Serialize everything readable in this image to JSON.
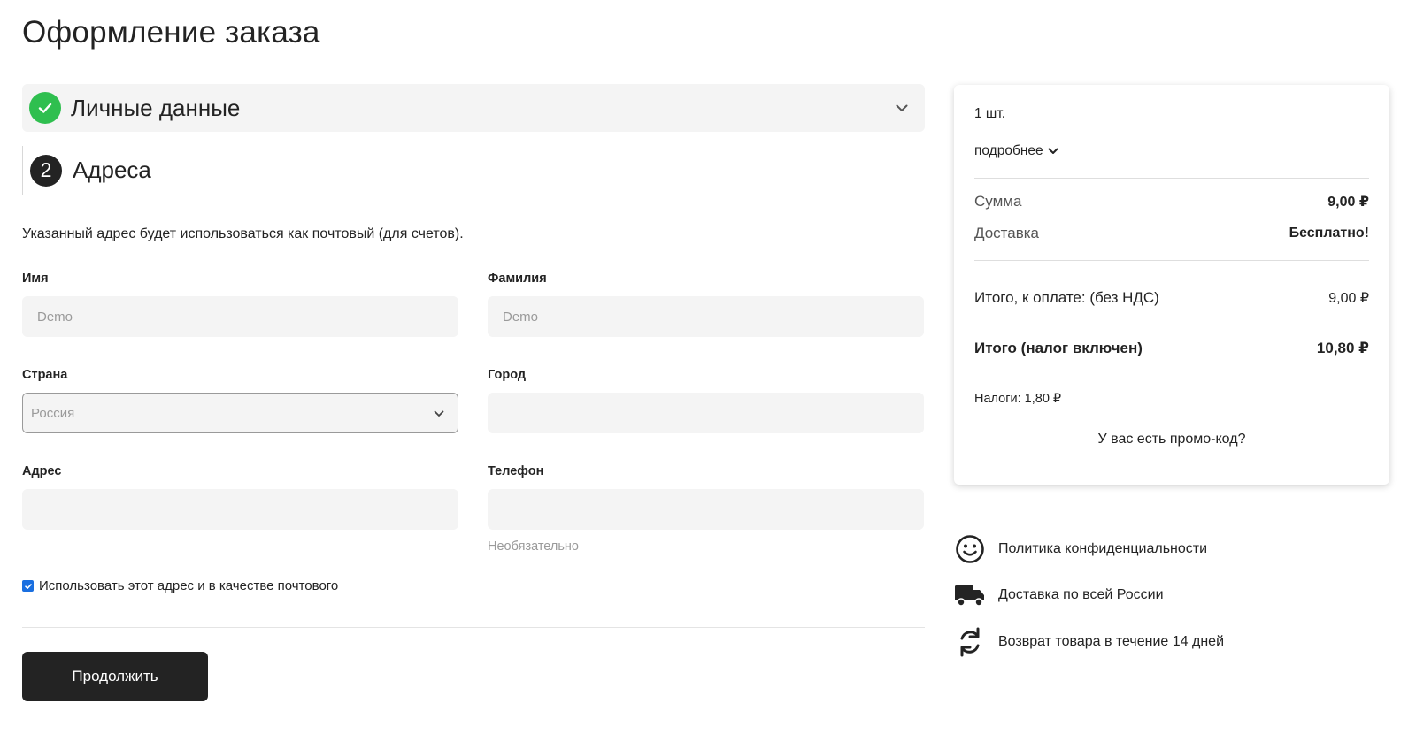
{
  "page": {
    "title": "Оформление заказа"
  },
  "steps": {
    "personal": {
      "title": "Личные данные",
      "done": true
    },
    "address": {
      "number": "2",
      "title": "Адреса"
    }
  },
  "address_form": {
    "info": "Указанный адрес будет использоваться как почтовый (для счетов).",
    "first_name": {
      "label": "Имя",
      "value": "Demo"
    },
    "last_name": {
      "label": "Фамилия",
      "value": "Demo"
    },
    "country": {
      "label": "Страна",
      "selected": "Россия"
    },
    "city": {
      "label": "Город",
      "value": ""
    },
    "address": {
      "label": "Адрес",
      "value": ""
    },
    "phone": {
      "label": "Телефон",
      "value": "",
      "hint": "Необязательно"
    },
    "use_as_billing": {
      "label": "Использовать этот адрес и в качестве почтового",
      "checked": true
    },
    "continue_label": "Продолжить"
  },
  "summary": {
    "quantity": "1 шт.",
    "details_label": "подробнее",
    "subtotal": {
      "label": "Сумма",
      "value": "9,00 ₽"
    },
    "shipping": {
      "label": "Доставка",
      "value": "Бесплатно!"
    },
    "total_excl": {
      "label": "Итого, к оплате: (без НДС)",
      "value": "9,00 ₽"
    },
    "total_incl": {
      "label": "Итого (налог включен)",
      "value": "10,80 ₽"
    },
    "taxes": "Налоги: 1,80 ₽",
    "promo": "У вас есть промо-код?"
  },
  "perks": [
    {
      "icon": "smile-icon",
      "text": "Политика конфиденциальности"
    },
    {
      "icon": "truck-icon",
      "text": "Доставка по всей России"
    },
    {
      "icon": "refresh-icon",
      "text": "Возврат товара в течение 14 дней"
    }
  ],
  "colors": {
    "success": "#2fbf4f",
    "primary": "#232323",
    "checkbox": "#1a6fe0"
  }
}
